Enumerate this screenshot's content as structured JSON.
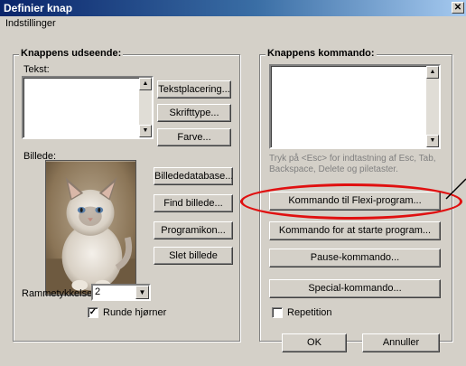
{
  "window": {
    "title": "Definier knap",
    "close_glyph": "✕"
  },
  "menu": {
    "settings": "Indstillinger"
  },
  "left_group": {
    "title": "Knappens udseende:",
    "text_label": "Tekst:",
    "image_label": "Billede:",
    "frame_label": "Rammetykkelse:",
    "frame_value": "2",
    "rounded_label": "Runde hjørner",
    "rounded_checked": true,
    "buttons": {
      "text_placement": "Tekstplacering...",
      "font": "Skrifttype...",
      "color": "Farve...",
      "image_database": "Billededatabase...",
      "find_image": "Find billede...",
      "program_icon": "Programikon...",
      "delete_image": "Slet billede"
    }
  },
  "right_group": {
    "title": "Knappens kommando:",
    "hint": "Tryk på <Esc> for indtastning af Esc, Tab, Backspace, Delete og piletaster.",
    "buttons": {
      "flexi_command": "Kommando til Flexi-program...",
      "start_program": "Kommando for at starte program...",
      "pause": "Pause-kommando...",
      "special": "Special-kommando..."
    },
    "repeat_label": "Repetition",
    "repeat_checked": false
  },
  "footer": {
    "ok": "OK",
    "cancel": "Annuller"
  },
  "colors": {
    "annotation": "#e01010",
    "titlebar": "#0a246a"
  },
  "icons": {
    "scroll_up": "▲",
    "scroll_down": "▼",
    "dropdown": "▼",
    "check": "✓"
  }
}
